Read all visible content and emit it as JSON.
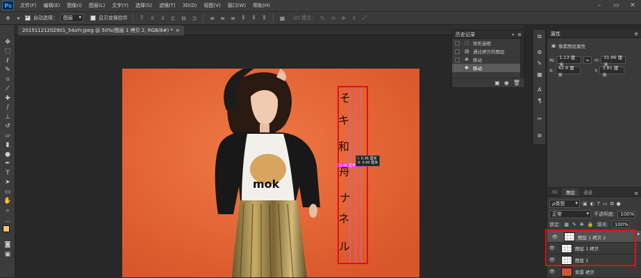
{
  "app": {
    "logo": "Ps"
  },
  "menu": [
    "文件(F)",
    "编辑(E)",
    "图像(I)",
    "图层(L)",
    "文字(Y)",
    "选择(S)",
    "滤镜(T)",
    "3D(D)",
    "视图(V)",
    "窗口(W)",
    "帮助(H)"
  ],
  "options": {
    "auto_select_label": "自动选择：",
    "auto_select_value": "图层",
    "show_transform_label": "显示变换控件",
    "mode_3d_label": "3D 模式："
  },
  "document": {
    "tab_title": "20151121202901_54aYr.jpeg @ 50%(图层 1 拷贝 2, RGB/8#) *",
    "close": "×"
  },
  "history": {
    "title": "历史记录",
    "items": [
      {
        "label": "矩形选框",
        "icon": "marquee-icon"
      },
      {
        "label": "通过拷贝的图层",
        "icon": "layer-icon"
      },
      {
        "label": "移动",
        "icon": "move-icon"
      },
      {
        "label": "移动",
        "icon": "move-icon"
      }
    ]
  },
  "properties": {
    "title": "属性",
    "section": "像素图层属性",
    "w_label": "W:",
    "w_value": "1.13 厘米",
    "h_label": "H:",
    "h_value": "31.96 厘米",
    "x_label": "X:",
    "x_value": "42.9 厘米",
    "y_label": "Y:",
    "y_value": "3.81 厘米",
    "link_icon": "∞"
  },
  "measure": {
    "tip1": "I: 0.36 厘米",
    "tip1b": "0: 0.00 厘米",
    "tip2": "0.36 厘米"
  },
  "layers_panel": {
    "tabs": [
      "3D",
      "图层",
      "通道"
    ],
    "kind_label": "ρ类型",
    "blend_mode": "正常",
    "opacity_label": "不透明度:",
    "opacity_value": "100%",
    "lock_label": "锁定:",
    "fill_label": "填充:",
    "fill_value": "100%",
    "layers": [
      {
        "name": "图层 1 拷贝 2"
      },
      {
        "name": "图层 1 拷贝"
      },
      {
        "name": "图层 1"
      },
      {
        "name": "背景 拷贝"
      }
    ]
  },
  "colors": {
    "accent_red": "#e0101a",
    "photo_bg": "#e8673a",
    "foreground": "#f2c66a"
  }
}
